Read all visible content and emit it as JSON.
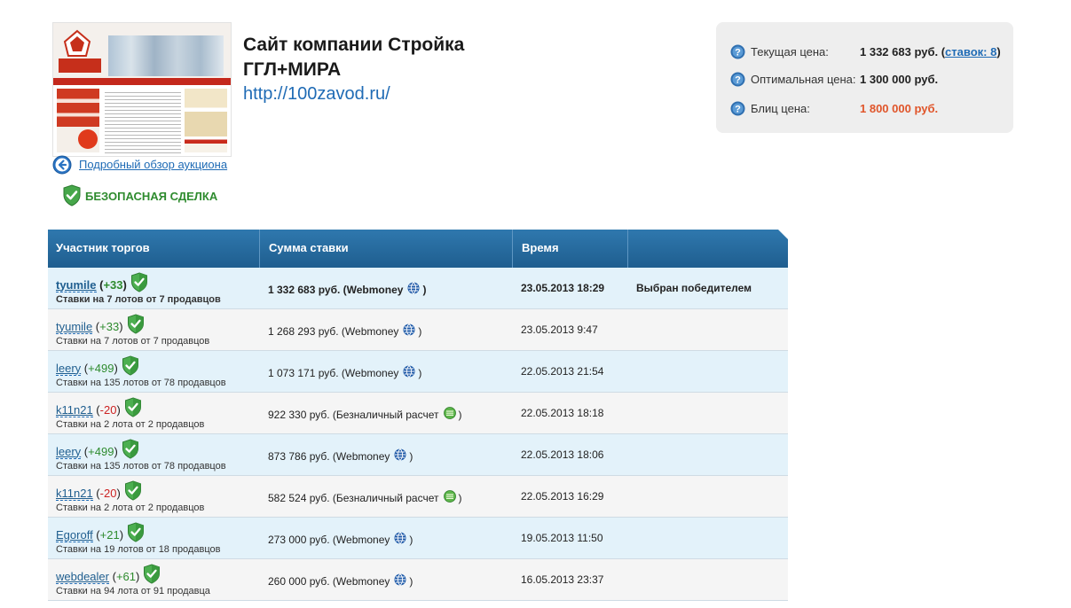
{
  "lot": {
    "title_line1": "Сайт компании Стройка",
    "title_line2": "ГГЛ+МИРА",
    "site_url": "http://100zavod.ru/",
    "back_link": "Подробный обзор аукциона",
    "safe_deal": "БЕЗОПАСНАЯ СДЕЛКА"
  },
  "prices": {
    "current_label": "Текущая цена:",
    "current_value": "1 332 683 руб.",
    "bids_link": "ставок: 8",
    "optimal_label": "Оптимальная цена:",
    "optimal_value": "1 300 000 руб.",
    "blitz_label": "Блиц цена:",
    "blitz_value": "1 800 000 руб.",
    "blitz_color": "#e0552a"
  },
  "table": {
    "headers": [
      "Участник торгов",
      "Сумма ставки",
      "Время",
      ""
    ],
    "rows": [
      {
        "nick": "tyumile",
        "rating": "+33",
        "rating_sign": "pos",
        "stats": "Ставки на 7 лотов от 7 продавцов",
        "amount": "1 332 683 руб. (Webmoney",
        "payment": "webmoney",
        "time": "23.05.2013 18:29",
        "status": "Выбран победителем"
      },
      {
        "nick": "tyumile",
        "rating": "+33",
        "rating_sign": "pos",
        "stats": "Ставки на 7 лотов от 7 продавцов",
        "amount": "1 268 293 руб. (Webmoney",
        "payment": "webmoney",
        "time": "23.05.2013 9:47",
        "status": ""
      },
      {
        "nick": "leery",
        "rating": "+499",
        "rating_sign": "pos",
        "stats": "Ставки на 135 лотов от 78 продавцов",
        "amount": "1 073 171 руб. (Webmoney",
        "payment": "webmoney",
        "time": "22.05.2013 21:54",
        "status": ""
      },
      {
        "nick": "k11n21",
        "rating": "-20",
        "rating_sign": "neg",
        "stats": "Ставки на 2 лота от 2 продавцов",
        "amount": "922 330 руб. (Безналичный расчет",
        "payment": "bank",
        "time": "22.05.2013 18:18",
        "status": ""
      },
      {
        "nick": "leery",
        "rating": "+499",
        "rating_sign": "pos",
        "stats": "Ставки на 135 лотов от 78 продавцов",
        "amount": "873 786 руб. (Webmoney",
        "payment": "webmoney",
        "time": "22.05.2013 18:06",
        "status": ""
      },
      {
        "nick": "k11n21",
        "rating": "-20",
        "rating_sign": "neg",
        "stats": "Ставки на 2 лота от 2 продавцов",
        "amount": "582 524 руб. (Безналичный расчет",
        "payment": "bank",
        "time": "22.05.2013 16:29",
        "status": ""
      },
      {
        "nick": "Egoroff",
        "rating": "+21",
        "rating_sign": "pos",
        "stats": "Ставки на 19 лотов от 18 продавцов",
        "amount": "273 000 руб. (Webmoney",
        "payment": "webmoney",
        "time": "19.05.2013 11:50",
        "status": ""
      },
      {
        "nick": "webdealer",
        "rating": "+61",
        "rating_sign": "pos",
        "stats": "Ставки на 94 лота от 91 продавца",
        "amount": "260 000 руб. (Webmoney",
        "payment": "webmoney",
        "time": "16.05.2013 23:37",
        "status": ""
      }
    ]
  },
  "icons": {
    "back": "arrow-left-circle-icon",
    "safe": "shield-check-icon",
    "help": "question-circle-icon",
    "webmoney": "webmoney-globe-icon",
    "bank": "bank-transfer-icon"
  }
}
